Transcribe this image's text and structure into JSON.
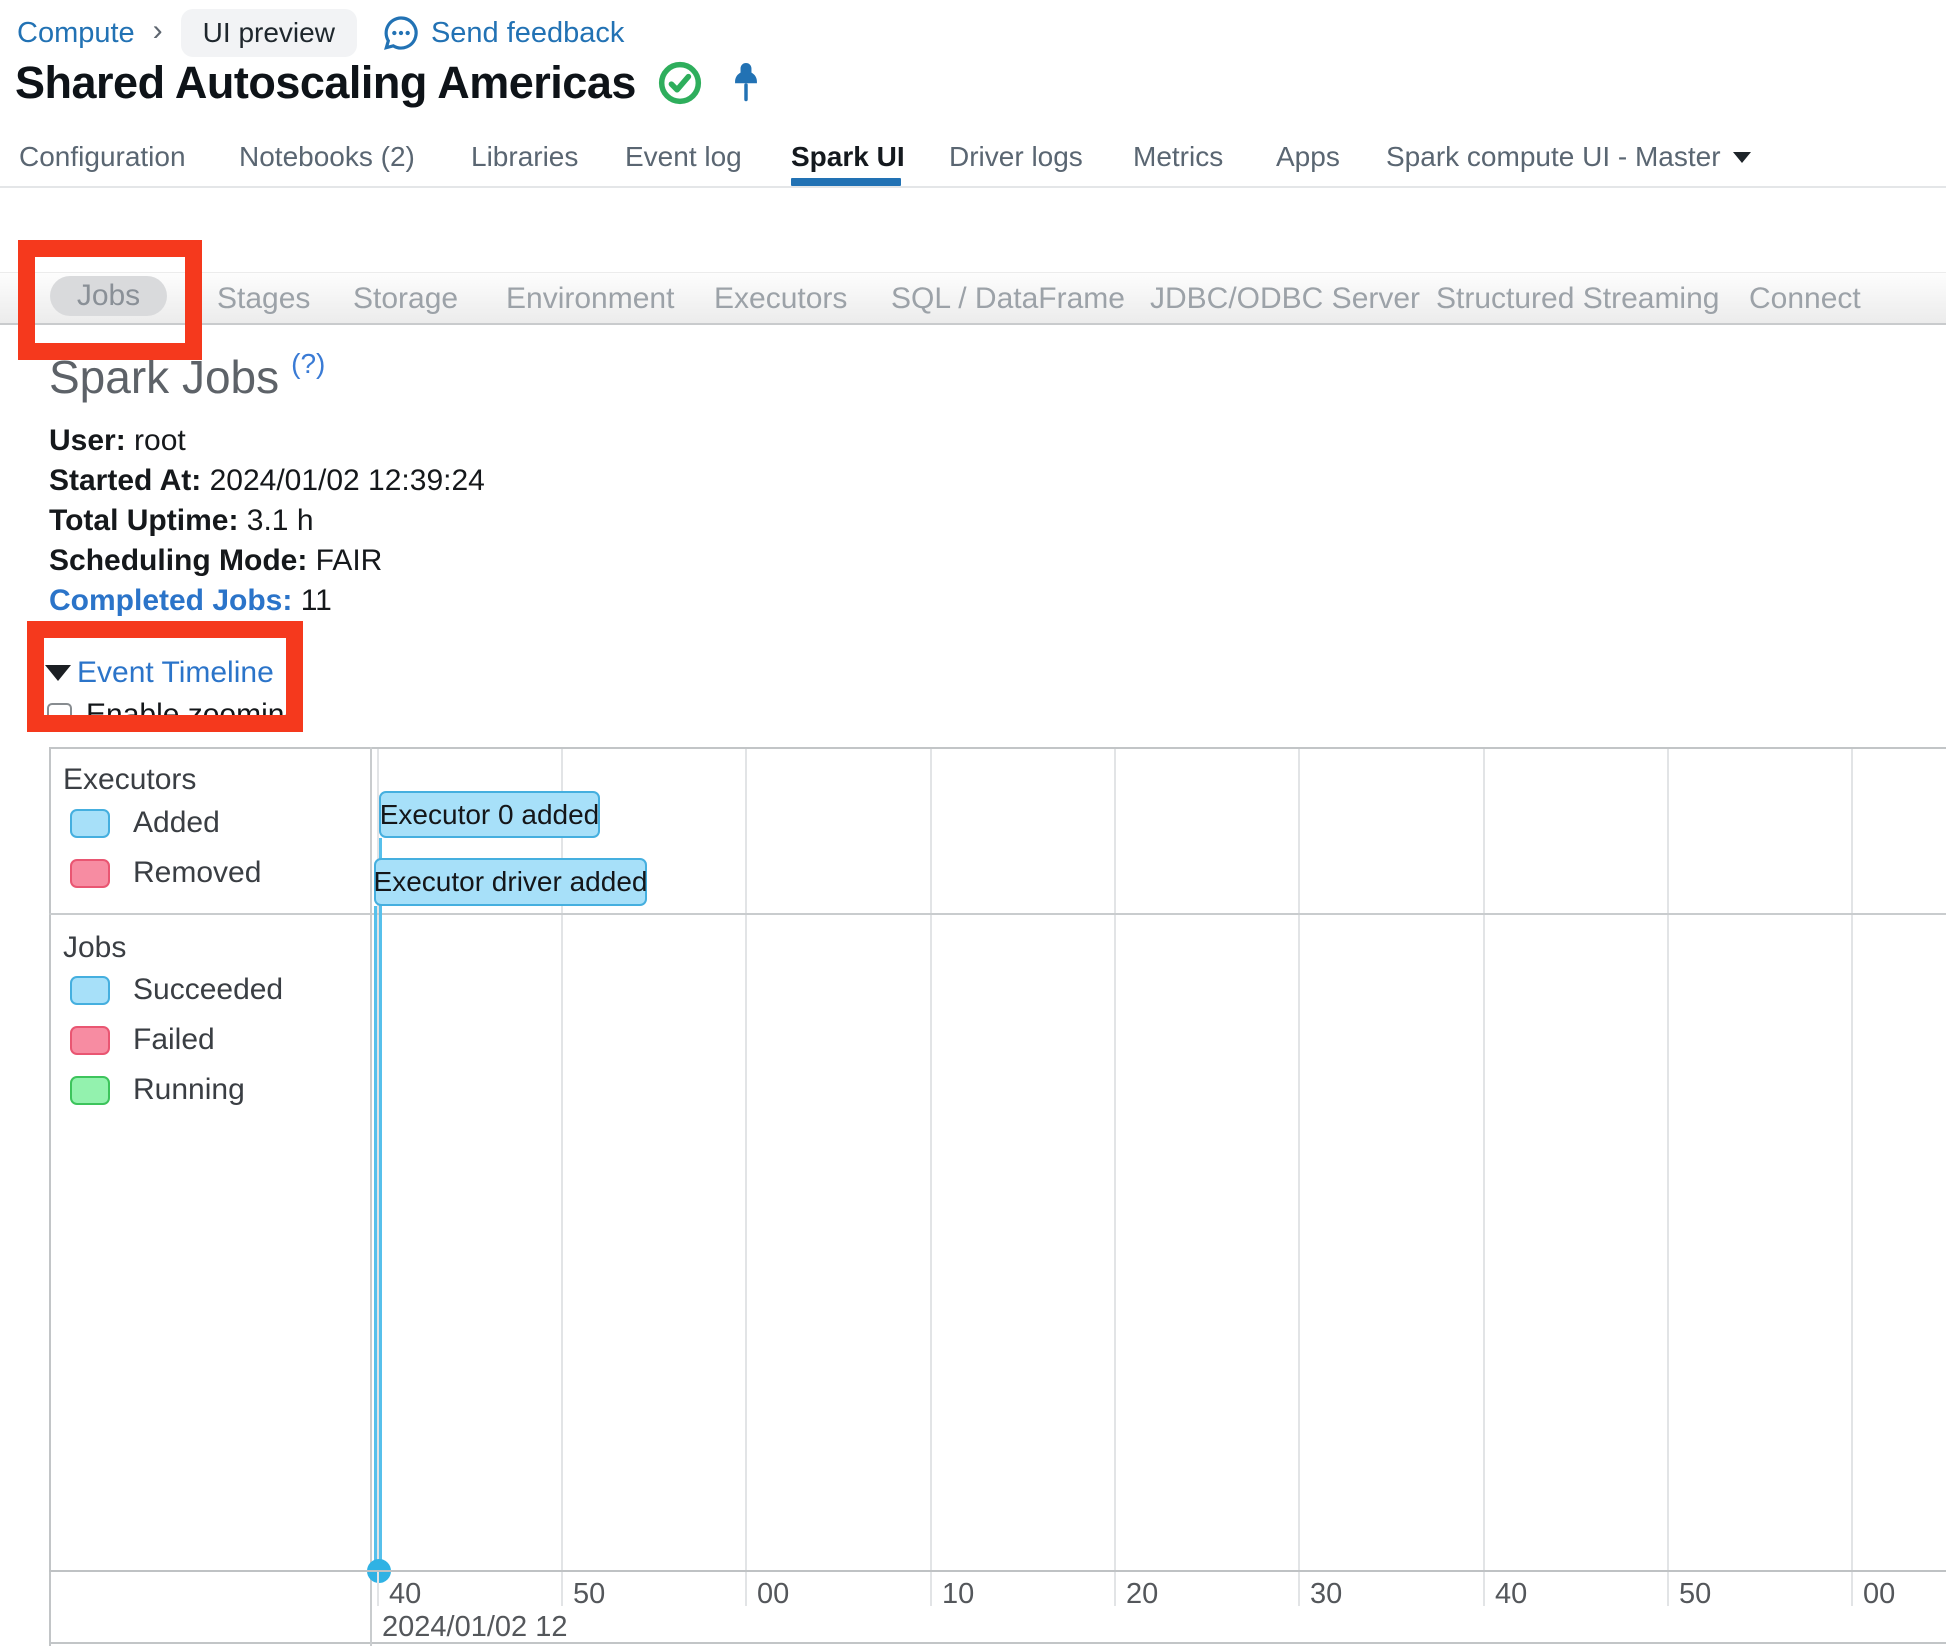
{
  "breadcrumb": {
    "compute": "Compute",
    "separator": "›",
    "chip": "UI preview",
    "feedback": "Send feedback"
  },
  "header": {
    "title": "Shared Autoscaling Americas"
  },
  "tabs": {
    "items": [
      {
        "label": "Configuration",
        "active": false
      },
      {
        "label": "Notebooks (2)",
        "active": false
      },
      {
        "label": "Libraries",
        "active": false
      },
      {
        "label": "Event log",
        "active": false
      },
      {
        "label": "Spark UI",
        "active": true
      },
      {
        "label": "Driver logs",
        "active": false
      },
      {
        "label": "Metrics",
        "active": false
      },
      {
        "label": "Apps",
        "active": false
      },
      {
        "label": "Spark compute UI - Master",
        "active": false,
        "has_caret": true
      }
    ]
  },
  "subtabs": {
    "active": "Jobs",
    "items": [
      {
        "label": "Jobs"
      },
      {
        "label": "Stages"
      },
      {
        "label": "Storage"
      },
      {
        "label": "Environment"
      },
      {
        "label": "Executors"
      },
      {
        "label": "SQL / DataFrame"
      },
      {
        "label": "JDBC/ODBC Server"
      },
      {
        "label": "Structured Streaming"
      },
      {
        "label": "Connect"
      }
    ]
  },
  "spark_jobs": {
    "heading": "Spark Jobs",
    "help": "(?)",
    "info": [
      {
        "label": "User:",
        "value": "root"
      },
      {
        "label": "Started At:",
        "value": "2024/01/02 12:39:24"
      },
      {
        "label": "Total Uptime:",
        "value": "3.1 h"
      },
      {
        "label": "Scheduling Mode:",
        "value": "FAIR"
      }
    ],
    "completed_jobs_label": "Completed Jobs:",
    "completed_jobs_value": "11"
  },
  "event_timeline": {
    "label": "Event Timeline",
    "enable_zoom_label": "Enable zooming",
    "checkbox_checked": false
  },
  "timeline": {
    "sections": [
      {
        "name": "Executors",
        "legend": [
          {
            "label": "Added",
            "fill": "#a7e0f9",
            "border": "#45afdf"
          },
          {
            "label": "Removed",
            "fill": "#f78ca2",
            "border": "#e95672"
          }
        ]
      },
      {
        "name": "Jobs",
        "legend": [
          {
            "label": "Succeeded",
            "fill": "#a7e0f9",
            "border": "#45afdf"
          },
          {
            "label": "Failed",
            "fill": "#f78ca2",
            "border": "#e95672"
          },
          {
            "label": "Running",
            "fill": "#93f2ae",
            "border": "#3dc45c"
          }
        ]
      }
    ],
    "events": [
      {
        "label": "Executor 0 added",
        "type": "executor-added"
      },
      {
        "label": "Executor driver added",
        "type": "executor-added"
      }
    ],
    "axis": {
      "ticks": [
        "40",
        "50",
        "00",
        "10",
        "20",
        "30",
        "40",
        "50",
        "00"
      ],
      "date_label": "2024/01/02 12"
    }
  },
  "colors": {
    "chrome_link_blue": "#2272b4",
    "spark_link_blue": "#2b74c9",
    "tab_underline": "#2272b4",
    "status_green": "#2eae5c",
    "annotation_red": "#f5391d",
    "event_blue_fill": "#a7e0f9",
    "event_blue_border": "#45afdf",
    "event_line_blue": "#57c0eb",
    "grid_gray": "#e2e4e6"
  }
}
